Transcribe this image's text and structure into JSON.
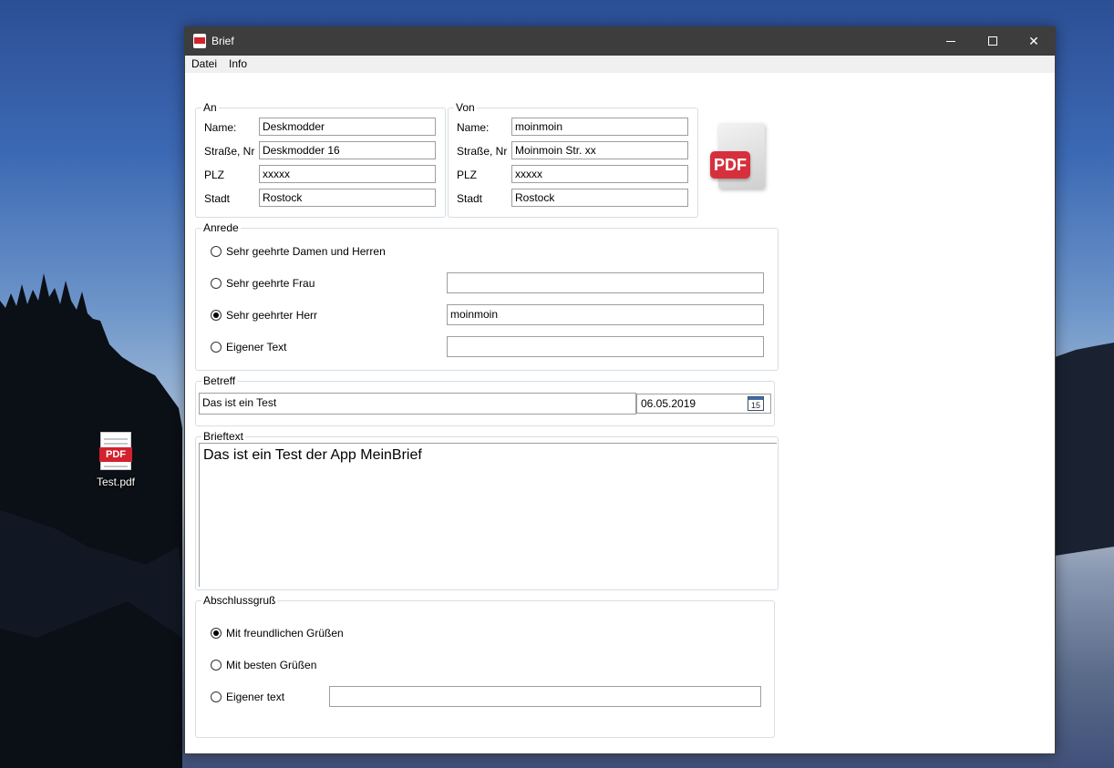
{
  "desktop": {
    "icon_label": "Test.pdf",
    "icon_badge": "PDF"
  },
  "window": {
    "title": "Brief",
    "menu": [
      "Datei",
      "Info"
    ],
    "pdf_button_label": "PDF"
  },
  "an": {
    "title": "An",
    "fields": [
      {
        "label": "Name:",
        "value": "Deskmodder"
      },
      {
        "label": "Straße, Nr",
        "value": "Deskmodder 16"
      },
      {
        "label": "PLZ",
        "value": "xxxxx"
      },
      {
        "label": "Stadt",
        "value": "Rostock"
      }
    ]
  },
  "von": {
    "title": "Von",
    "fields": [
      {
        "label": "Name:",
        "value": "moinmoin"
      },
      {
        "label": "Straße, Nr",
        "value": "Moinmoin Str. xx"
      },
      {
        "label": "PLZ",
        "value": "xxxxx"
      },
      {
        "label": "Stadt",
        "value": "Rostock"
      }
    ]
  },
  "anrede": {
    "title": "Anrede",
    "options": [
      {
        "label": "Sehr geehrte Damen und Herren",
        "checked": false,
        "value": null
      },
      {
        "label": "Sehr geehrte Frau",
        "checked": false,
        "value": ""
      },
      {
        "label": "Sehr geehrter Herr",
        "checked": true,
        "value": "moinmoin"
      },
      {
        "label": "Eigener Text",
        "checked": false,
        "value": ""
      }
    ]
  },
  "betreff": {
    "title": "Betreff",
    "value": "Das ist ein Test",
    "date": "06.05.2019",
    "calendar_day": "15"
  },
  "brieftext": {
    "title": "Brieftext",
    "value": "Das ist ein Test der App MeinBrief"
  },
  "abschluss": {
    "title": "Abschlussgruß",
    "options": [
      {
        "label": "Mit freundlichen Grüßen",
        "checked": true
      },
      {
        "label": "Mit besten Grüßen",
        "checked": false
      },
      {
        "label": "Eigener text",
        "checked": false,
        "value": ""
      }
    ]
  },
  "colors": {
    "titlebar": "#3d3d3d",
    "menubar": "#f0f0f0",
    "group_border": "#d5dfe5",
    "pdf_red": "#d6303c"
  }
}
